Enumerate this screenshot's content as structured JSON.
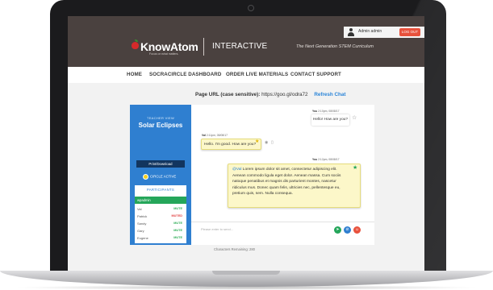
{
  "header": {
    "admin_name": "Admin admin",
    "logout_label": "LOG OUT",
    "logo_text": "KnowAtom",
    "logo_tagline": "Focus on what matters.",
    "product": "INTERACTIVE",
    "tagline": "The Next Generation STEM Curriculum"
  },
  "nav": [
    "HOME",
    "SOCRACIRCLE DASHBOARD",
    "ORDER LIVE MATERIALS",
    "CONTACT SUPPORT"
  ],
  "page_url": {
    "label": "Page URL (case sensitive):",
    "url": "https://goo.gl/odra72",
    "refresh_label": "Refresh Chat"
  },
  "left_panel": {
    "view_label": "TEACHER VIEW",
    "title": "Solar Eclipses",
    "print_button": "Print/Download",
    "circle_status": "CIRCLE ACTIVE",
    "participants_header": "PARTICIPANTS",
    "current_user": "wpadmin",
    "participants": [
      {
        "name": "Val",
        "action": "MUTE"
      },
      {
        "name": "Patrick",
        "action": "MUTED"
      },
      {
        "name": "Sandy",
        "action": "MUTE"
      },
      {
        "name": "Gary",
        "action": "MUTE"
      },
      {
        "name": "Eugene",
        "action": "MUTE"
      }
    ]
  },
  "messages": [
    {
      "author": "You",
      "time": "2:10pm, 08/08/17",
      "text": "Hello! How are you?"
    },
    {
      "author": "Val",
      "time": "2:11pm, 08/08/17",
      "text": "Hello. I'm good. How are you?"
    },
    {
      "author": "You",
      "time": "2:12pm, 08/08/17",
      "mention": "@Val",
      "text": "Lorem ipsum dolor sit amet, consectetur adipiscing elit. Aenean commodo ligula eget dolor. Aenean massa. Cum sociis natoque penatibus et magnis dis parturient montes, nascetur ridiculus mus. Donec quam felis, ultricies nec, pellentesque eu, pretium quis, sem. Nulla consequa."
    }
  ],
  "composer": {
    "placeholder": "Please enter to send...",
    "remaining": "Characters Remaining: 280"
  }
}
